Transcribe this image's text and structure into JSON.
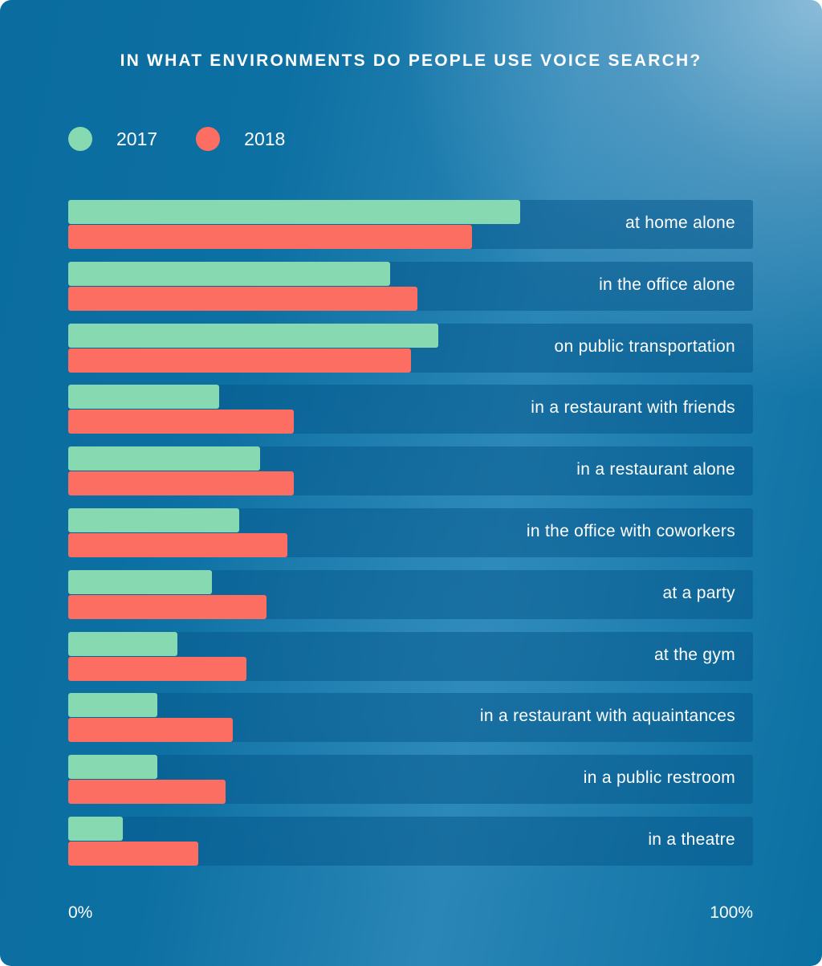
{
  "chart_data": {
    "type": "bar",
    "orientation": "horizontal",
    "title": "IN WHAT ENVIRONMENTS DO PEOPLE USE VOICE SEARCH?",
    "xlabel": "",
    "ylabel": "",
    "xlim": [
      0,
      100
    ],
    "unit": "%",
    "x_ticks": [
      "0%",
      "100%"
    ],
    "legend_position": "top-left",
    "grid": false,
    "categories": [
      "at home alone",
      "in the office alone",
      "on public transportation",
      "in a restaurant with friends",
      "in a restaurant alone",
      "in the office with coworkers",
      "at a party",
      "at the gym",
      "in a restaurant with aquaintances",
      "in a public restroom",
      "in a theatre"
    ],
    "series": [
      {
        "name": "2017",
        "color": "#86d9b0",
        "values": [
          66,
          47,
          54,
          22,
          28,
          25,
          21,
          16,
          13,
          13,
          8
        ]
      },
      {
        "name": "2018",
        "color": "#fd6e62",
        "values": [
          59,
          51,
          50,
          33,
          33,
          32,
          29,
          26,
          24,
          23,
          19
        ]
      }
    ]
  }
}
